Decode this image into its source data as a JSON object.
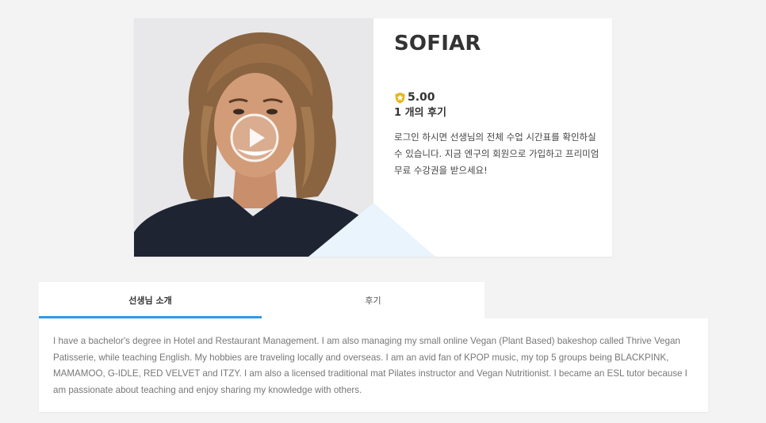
{
  "profile": {
    "name": "SOFIAR",
    "rating": "5.00",
    "review_count": "1 개의 후기",
    "login_notice": "로그인 하시면 선생님의 전체 수업 시간표를 확인하실 수 있습니다. 지금 엔구의 회원으로 가입하고 프리미엄 무료 수강권을 받으세요!"
  },
  "tabs": [
    {
      "label": "선생님 소개",
      "active": true
    },
    {
      "label": "후기",
      "active": false
    }
  ],
  "intro": {
    "text": "I have a bachelor's degree in Hotel and Restaurant Management. I am also managing my small online Vegan (Plant Based) bakeshop called Thrive Vegan Patisserie, while teaching English. My hobbies are traveling locally and overseas. I am an avid fan of KPOP music, my top 5 groups being BLACKPINK, MAMAMOO, G-IDLE, RED VELVET and ITZY. I am also a licensed traditional mat Pilates instructor and Vegan Nutritionist. I became an ESL tutor because I am passionate about teaching and enjoy sharing my knowledge with others."
  },
  "colors": {
    "accent": "#2f9be8",
    "star_badge": "#e5b81c",
    "page_bg": "#f3f3f3"
  },
  "icons": {
    "play": "play-circle-icon",
    "rating": "star-shield-icon"
  }
}
